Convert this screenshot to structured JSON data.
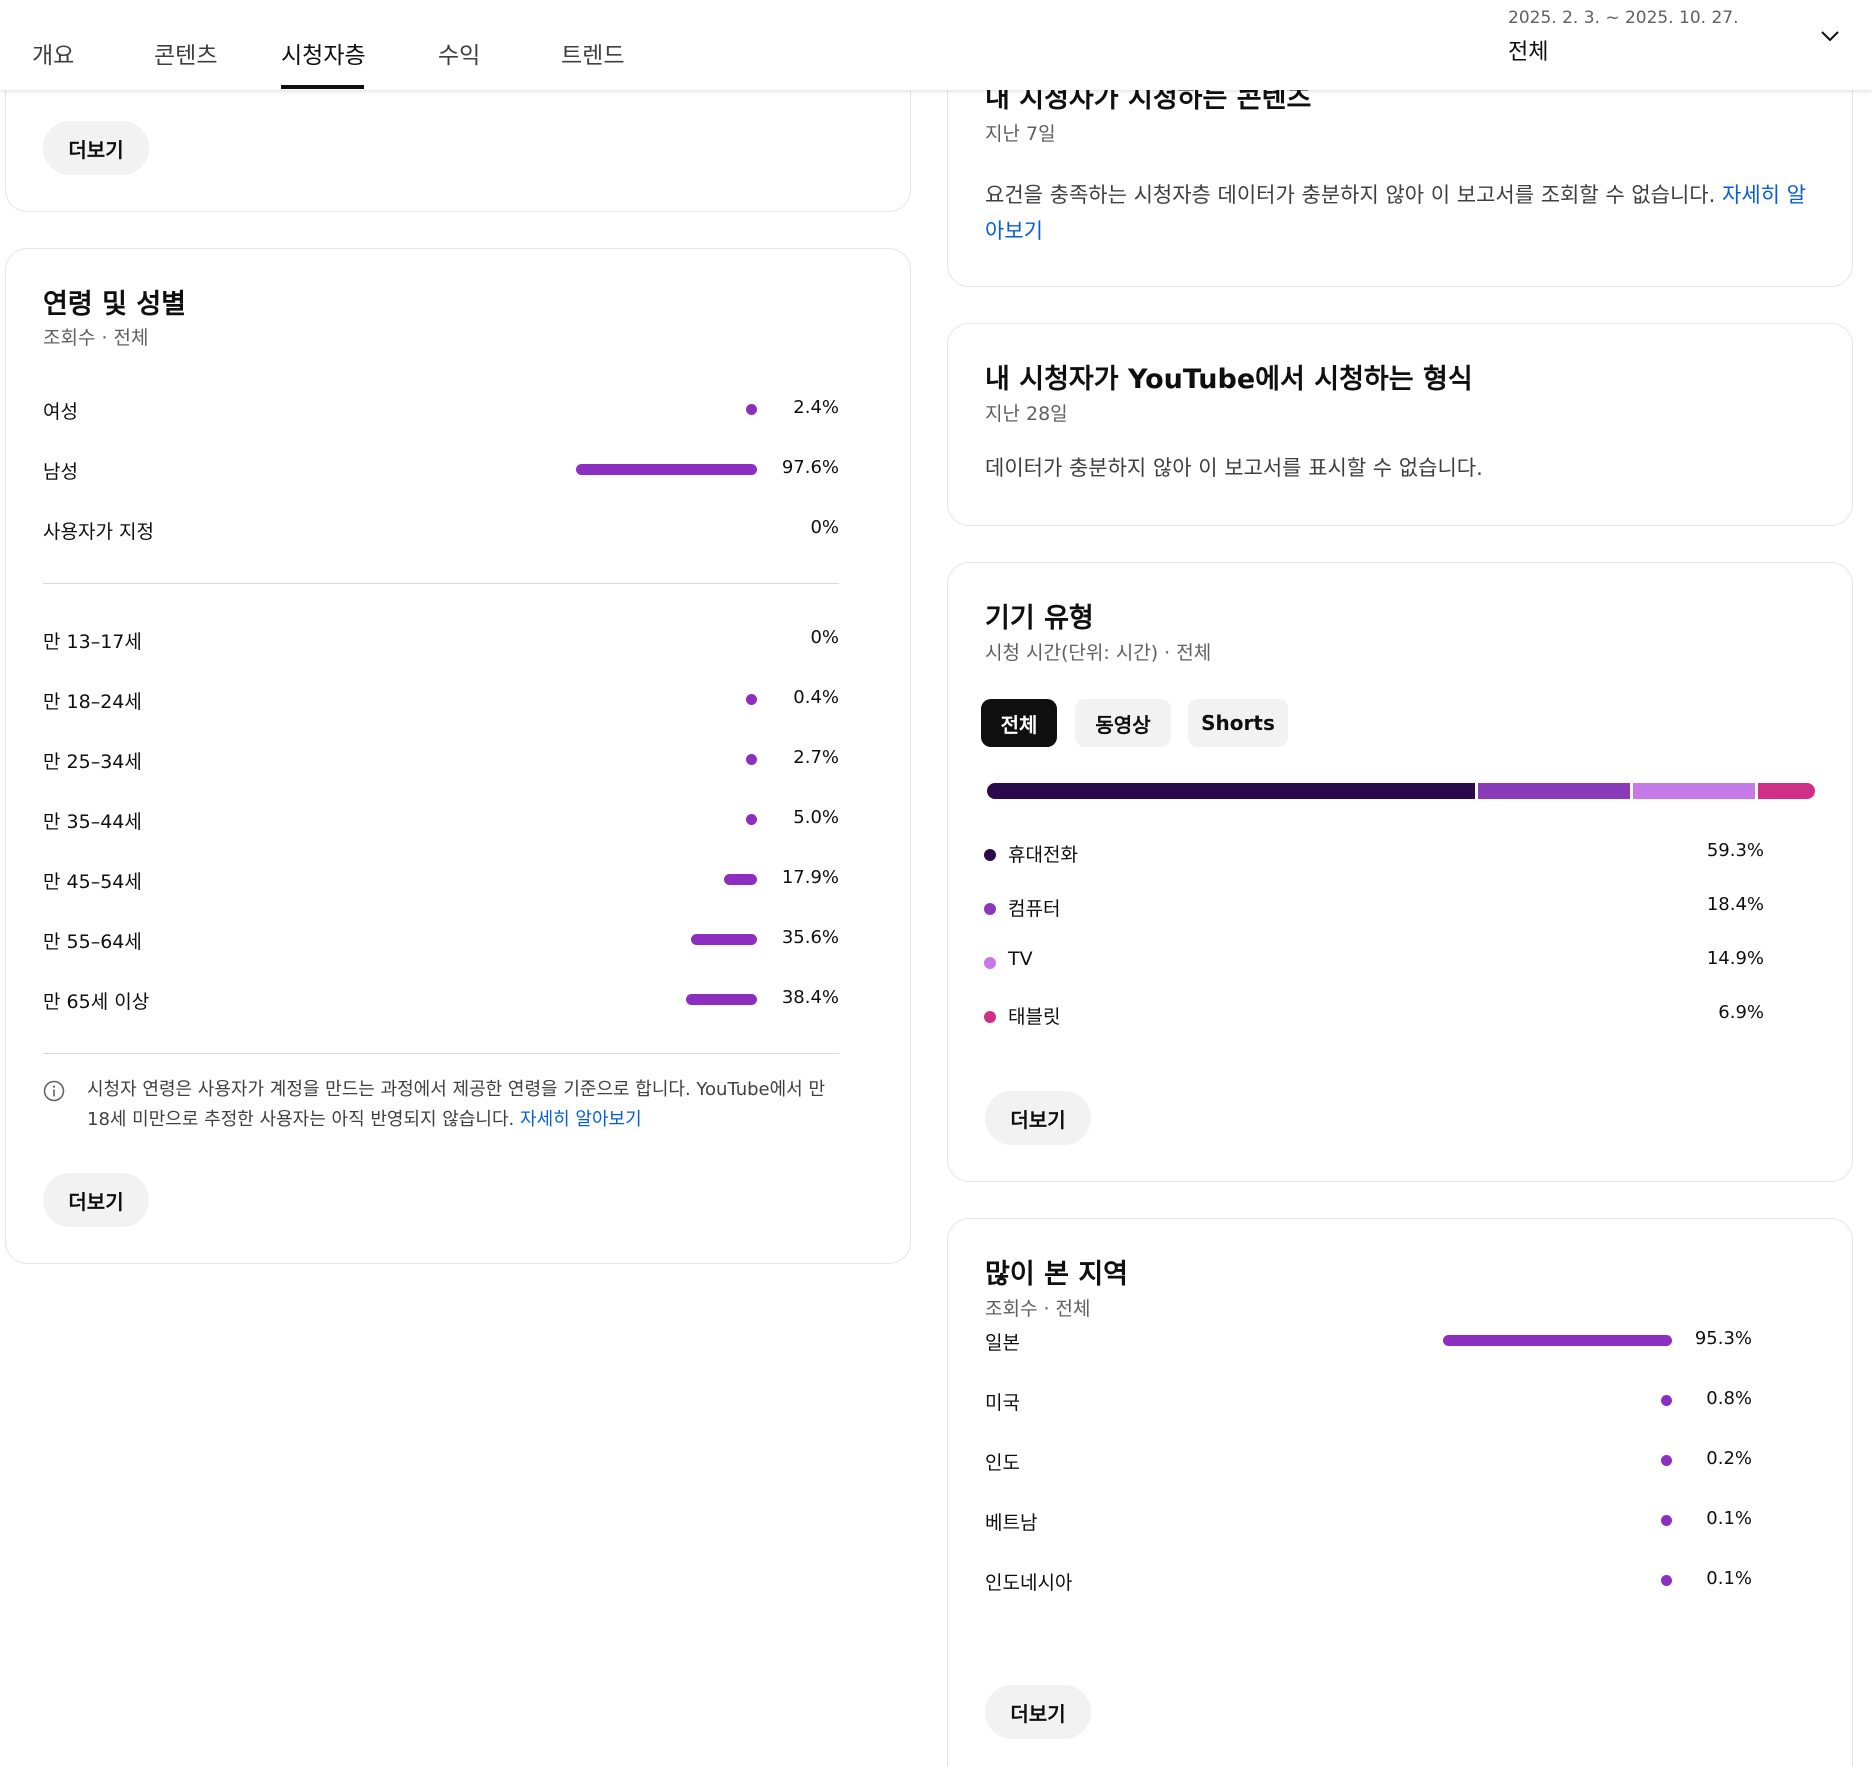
{
  "nav": {
    "tabs": [
      {
        "label": "개요",
        "active": false
      },
      {
        "label": "콘텐츠",
        "active": false
      },
      {
        "label": "시청자층",
        "active": true
      },
      {
        "label": "수익",
        "active": false
      },
      {
        "label": "트렌드",
        "active": false
      }
    ],
    "date_range": "2025. 2. 3. ~ 2025. 10. 27.",
    "date_scope": "전체",
    "dropdown_icon": "chevron-down-icon"
  },
  "top_card": {
    "more_label": "더보기"
  },
  "age_gender": {
    "title": "연령 및 성별",
    "subtitle": "조회수 · 전체",
    "bar_color": "#8c2fc1",
    "gender": [
      {
        "label": "여성",
        "percent": 2.4,
        "value": "2.4%"
      },
      {
        "label": "남성",
        "percent": 97.6,
        "value": "97.6%"
      },
      {
        "label": "사용자가 지정",
        "percent": 0,
        "value": "0%"
      }
    ],
    "age": [
      {
        "label": "만 13–17세",
        "percent": 0,
        "value": "0%"
      },
      {
        "label": "만 18–24세",
        "percent": 0.4,
        "value": "0.4%"
      },
      {
        "label": "만 25–34세",
        "percent": 2.7,
        "value": "2.7%"
      },
      {
        "label": "만 35–44세",
        "percent": 5.0,
        "value": "5.0%"
      },
      {
        "label": "만 45–54세",
        "percent": 17.9,
        "value": "17.9%"
      },
      {
        "label": "만 55–64세",
        "percent": 35.6,
        "value": "35.6%"
      },
      {
        "label": "만 65세 이상",
        "percent": 38.4,
        "value": "38.4%"
      }
    ],
    "note_text": "시청자 연령은 사용자가 계정을 만드는 과정에서 제공한 연령을 기준으로 합니다. YouTube에서 만 18세 미만으로 추정한 사용자는 아직 반영되지 않습니다.",
    "note_link": "자세히 알아보기",
    "note_icon": "info-icon",
    "more_label": "더보기"
  },
  "watched_content": {
    "title": "내 시청자가 시청하는 콘텐츠",
    "subtitle": "지난 7일",
    "message": "요건을 충족하는 시청자층 데이터가 충분하지 않아 이 보고서를 조회할 수 없습니다.",
    "link": "자세히 알아보기"
  },
  "formats": {
    "title": "내 시청자가 YouTube에서 시청하는 형식",
    "subtitle": "지난 28일",
    "message": "데이터가 충분하지 않아 이 보고서를 표시할 수 없습니다."
  },
  "device": {
    "title": "기기 유형",
    "subtitle": "시청 시간(단위: 시간) · 전체",
    "filters": [
      {
        "label": "전체",
        "active": true
      },
      {
        "label": "동영상",
        "active": false
      },
      {
        "label": "Shorts",
        "active": false
      }
    ],
    "items": [
      {
        "label": "휴대전화",
        "percent": 59.3,
        "value": "59.3%",
        "color": "#2a0a4a"
      },
      {
        "label": "컴퓨터",
        "percent": 18.4,
        "value": "18.4%",
        "color": "#8a3bb8"
      },
      {
        "label": "TV",
        "percent": 14.9,
        "value": "14.9%",
        "color": "#c57ae8"
      },
      {
        "label": "태블릿",
        "percent": 6.9,
        "value": "6.9%",
        "color": "#cf2f86"
      }
    ],
    "more_label": "더보기"
  },
  "geo": {
    "title": "많이 본 지역",
    "subtitle": "조회수 · 전체",
    "bar_color": "#8c2fc1",
    "items": [
      {
        "label": "일본",
        "percent": 95.3,
        "value": "95.3%"
      },
      {
        "label": "미국",
        "percent": 0.8,
        "value": "0.8%"
      },
      {
        "label": "인도",
        "percent": 0.2,
        "value": "0.2%"
      },
      {
        "label": "베트남",
        "percent": 0.1,
        "value": "0.1%"
      },
      {
        "label": "인도네시아",
        "percent": 0.1,
        "value": "0.1%"
      }
    ],
    "more_label": "더보기"
  }
}
